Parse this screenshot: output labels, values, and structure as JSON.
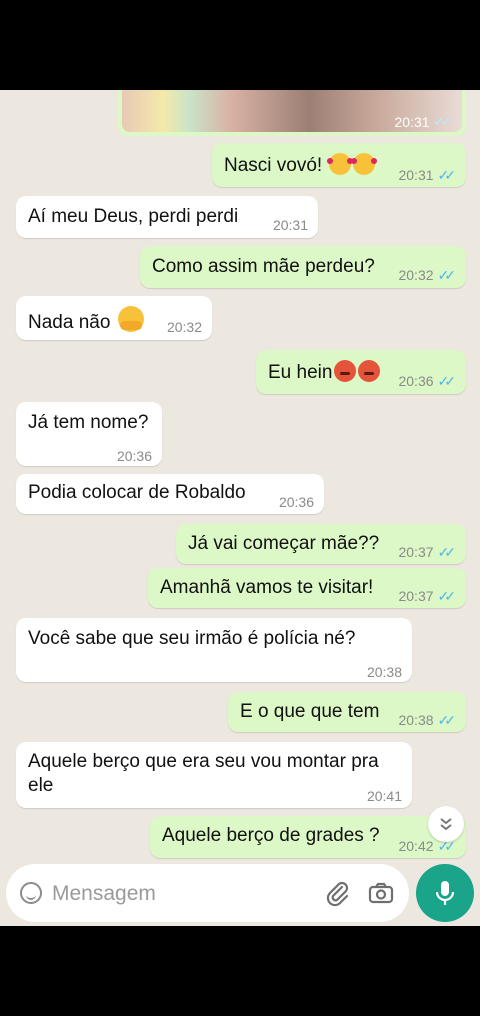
{
  "photo_message": {
    "time": "20:31",
    "ticks": "✓✓"
  },
  "messages": [
    {
      "dir": "out",
      "text": "Nasci vovó!",
      "time": "20:31",
      "ticks": "✓✓"
    },
    {
      "dir": "in",
      "text": "Aí meu Deus, perdi perdi",
      "time": "20:31"
    },
    {
      "dir": "out",
      "text": "Como assim mãe perdeu?",
      "time": "20:32",
      "ticks": "✓✓"
    },
    {
      "dir": "in",
      "text": "Nada não",
      "time": "20:32"
    },
    {
      "dir": "out",
      "text": "Eu hein",
      "time": "20:36",
      "ticks": "✓✓"
    },
    {
      "dir": "in",
      "text": "Já tem nome?",
      "time": "20:36"
    },
    {
      "dir": "in",
      "text": "Podia colocar de Robaldo",
      "time": "20:36"
    },
    {
      "dir": "out",
      "text": "Já vai começar mãe??",
      "time": "20:37",
      "ticks": "✓✓"
    },
    {
      "dir": "out",
      "text": "Amanhã vamos te visitar!",
      "time": "20:37",
      "ticks": "✓✓"
    },
    {
      "dir": "in",
      "text": "Você sabe que seu irmão é polícia né?",
      "time": "20:38"
    },
    {
      "dir": "out",
      "text": "E o que que tem",
      "time": "20:38",
      "ticks": "✓✓"
    },
    {
      "dir": "in",
      "text_line1": "Aquele berço que era seu vou montar pra",
      "text_line2": "ele",
      "time": "20:41"
    },
    {
      "dir": "out",
      "text": "Aquele berço de grades ?",
      "time": "20:42",
      "ticks": "✓✓"
    }
  ],
  "composer": {
    "placeholder": "Mensagem"
  },
  "icons": {
    "scroll_down": "double-chevron-down-icon",
    "emoji": "emoji-icon",
    "attach": "paperclip-icon",
    "camera": "camera-icon",
    "mic": "microphone-icon"
  },
  "colors": {
    "chat_background": "#ece7df",
    "outgoing_bubble": "#dcf8c6",
    "incoming_bubble": "#ffffff",
    "read_ticks": "#4fb6ec",
    "mic_button": "#1aa489"
  }
}
